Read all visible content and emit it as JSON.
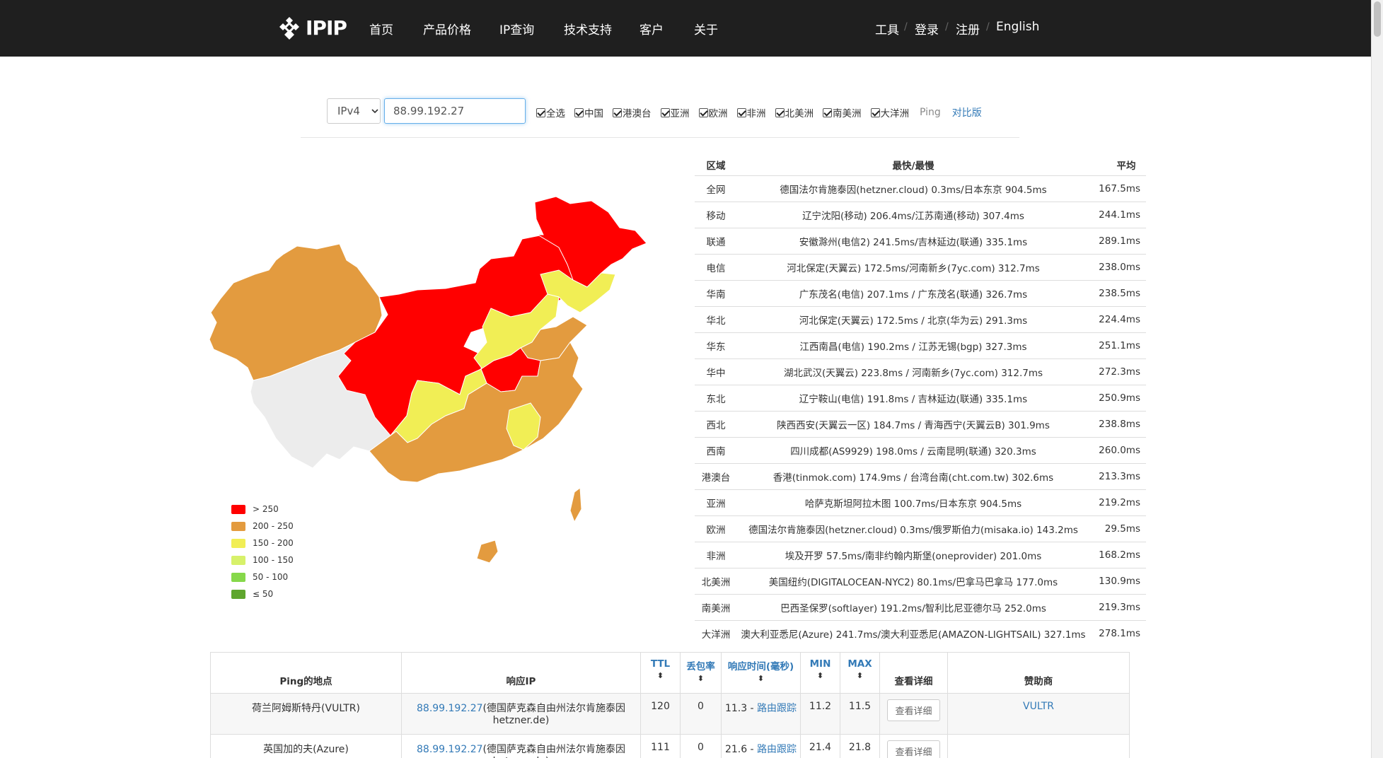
{
  "nav": {
    "logo": "IPIP",
    "left_items": [
      "首页",
      "产品价格",
      "IP查询",
      "技术支持",
      "客户",
      "关于"
    ],
    "right_items": [
      "工具",
      "登录",
      "注册",
      "English"
    ]
  },
  "query": {
    "ip_version": "IPv4",
    "ip_value": "88.99.192.27",
    "checkboxes": [
      "全选",
      "中国",
      "港澳台",
      "亚洲",
      "欧洲",
      "非洲",
      "北美洲",
      "南美洲",
      "大洋洲"
    ],
    "ping_label": "Ping",
    "compare_label": "对比版"
  },
  "legend": [
    {
      "label": "> 250",
      "color": "#ff0000"
    },
    {
      "label": "200 - 250",
      "color": "#e39b3f"
    },
    {
      "label": "150 - 200",
      "color": "#f1ee55"
    },
    {
      "label": "100 - 150",
      "color": "#d7f16a"
    },
    {
      "label": "50 - 100",
      "color": "#86d84a"
    },
    {
      "label": "≤ 50",
      "color": "#5fa62e"
    }
  ],
  "region_table": {
    "headers": {
      "region": "区域",
      "fastest": "最快/最慢",
      "avg": "平均"
    },
    "rows": [
      {
        "region": "全网",
        "detail": "德国法尔肯施泰因(hetzner.cloud) 0.3ms/日本东京 904.5ms",
        "avg": "167.5ms"
      },
      {
        "region": "移动",
        "detail": "辽宁沈阳(移动) 206.4ms/江苏南通(移动) 307.4ms",
        "avg": "244.1ms"
      },
      {
        "region": "联通",
        "detail": "安徽滁州(电信2) 241.5ms/吉林延边(联通) 335.1ms",
        "avg": "289.1ms"
      },
      {
        "region": "电信",
        "detail": "河北保定(天翼云) 172.5ms/河南新乡(7yc.com) 312.7ms",
        "avg": "238.0ms"
      },
      {
        "region": "华南",
        "detail": "广东茂名(电信) 207.1ms / 广东茂名(联通) 326.7ms",
        "avg": "238.5ms"
      },
      {
        "region": "华北",
        "detail": "河北保定(天翼云) 172.5ms / 北京(华为云) 291.3ms",
        "avg": "224.4ms"
      },
      {
        "region": "华东",
        "detail": "江西南昌(电信) 190.2ms / 江苏无锡(bgp) 327.3ms",
        "avg": "251.1ms"
      },
      {
        "region": "华中",
        "detail": "湖北武汉(天翼云) 223.8ms / 河南新乡(7yc.com) 312.7ms",
        "avg": "272.3ms"
      },
      {
        "region": "东北",
        "detail": "辽宁鞍山(电信) 191.8ms / 吉林延边(联通) 335.1ms",
        "avg": "250.9ms"
      },
      {
        "region": "西北",
        "detail": "陕西西安(天翼云一区) 184.7ms / 青海西宁(天翼云B) 301.9ms",
        "avg": "238.8ms"
      },
      {
        "region": "西南",
        "detail": "四川成都(AS9929) 198.0ms / 云南昆明(联通) 320.3ms",
        "avg": "260.0ms"
      },
      {
        "region": "港澳台",
        "detail": "香港(tinmok.com) 174.9ms / 台湾台南(cht.com.tw) 302.6ms",
        "avg": "213.3ms"
      },
      {
        "region": "亚洲",
        "detail": "哈萨克斯坦阿拉木图 100.7ms/日本东京 904.5ms",
        "avg": "219.2ms"
      },
      {
        "region": "欧洲",
        "detail": "德国法尔肯施泰因(hetzner.cloud) 0.3ms/俄罗斯伯力(misaka.io) 143.2ms",
        "avg": "29.5ms"
      },
      {
        "region": "非洲",
        "detail": "埃及开罗 57.5ms/南非约翰内斯堡(oneprovider) 201.0ms",
        "avg": "168.2ms"
      },
      {
        "region": "北美洲",
        "detail": "美国纽约(DIGITALOCEAN-NYC2) 80.1ms/巴拿马巴拿马 177.0ms",
        "avg": "130.9ms"
      },
      {
        "region": "南美洲",
        "detail": "巴西圣保罗(softlayer) 191.2ms/智利比尼亚德尔马 252.0ms",
        "avg": "219.3ms"
      },
      {
        "region": "大洋洲",
        "detail": "澳大利亚悉尼(Azure) 241.7ms/澳大利亚悉尼(AMAZON-LIGHTSAIL) 327.1ms",
        "avg": "278.1ms"
      }
    ]
  },
  "ping_table": {
    "headers": {
      "location": "Ping的地点",
      "ip": "响应IP",
      "ttl": "TTL",
      "loss": "丢包率",
      "rtt": "响应时间(毫秒)",
      "min": "MIN",
      "max": "MAX",
      "detail": "查看详细",
      "sponsor": "赞助商"
    },
    "rows": [
      {
        "location": "荷兰阿姆斯特丹(VULTR)",
        "ip": "88.99.192.27",
        "ip_info": "(德国萨克森自由州法尔肯施泰因hetzner.de)",
        "ttl": "120",
        "loss": "0",
        "rtt": "11.3",
        "route": "路由跟踪",
        "min": "11.2",
        "max": "11.5",
        "detail_btn": "查看详细",
        "sponsor": "VULTR"
      },
      {
        "location": "英国加的夫(Azure)",
        "ip": "88.99.192.27",
        "ip_info": "(德国萨克森自由州法尔肯施泰因hetzner.de)",
        "ttl": "111",
        "loss": "0",
        "rtt": "21.6",
        "route": "路由跟踪",
        "min": "21.4",
        "max": "21.8",
        "detail_btn": "查看详细",
        "sponsor": ""
      }
    ]
  }
}
